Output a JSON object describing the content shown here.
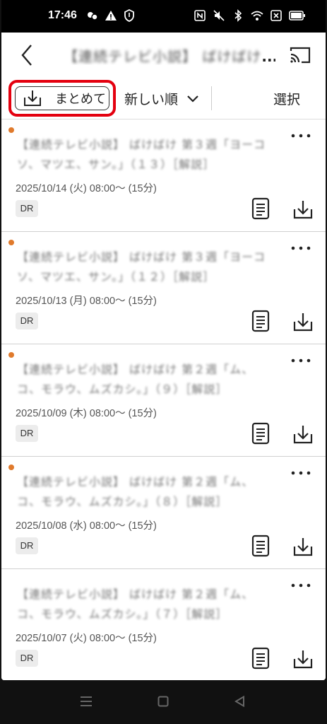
{
  "status": {
    "time": "17:46",
    "left_icons": [
      "link-icon",
      "warning-icon",
      "shield-icon"
    ],
    "right_icons": [
      "nfc-icon",
      "mute-icon",
      "bluetooth-icon",
      "wifi-icon",
      "x-box-icon",
      "battery-icon"
    ]
  },
  "appbar": {
    "title_blurred": "【連続テレビ小説】 ばけばけ",
    "title_ellipsis": "..."
  },
  "toolbar": {
    "bulk_download_label": "まとめて",
    "sort_label": "新しい順",
    "select_label": "選択"
  },
  "episodes": [
    {
      "title": "【連続テレビ小説】 ばけばけ 第３週「ヨーコソ、マツエ、サン。」（１３）［解説］",
      "date": "2025/10/14 (火) 08:00～ (15分)",
      "badge": "DR"
    },
    {
      "title": "【連続テレビ小説】 ばけばけ 第３週「ヨーコソ、マツエ、サン。」（１２）［解説］",
      "date": "2025/10/13 (月) 08:00～ (15分)",
      "badge": "DR"
    },
    {
      "title": "【連続テレビ小説】 ばけばけ 第２週「ム、コ、モラウ、ムズカシ。」（９）［解説］",
      "date": "2025/10/09 (木) 08:00～ (15分)",
      "badge": "DR"
    },
    {
      "title": "【連続テレビ小説】 ばけばけ 第２週「ム、コ、モラウ、ムズカシ。」（８）［解説］",
      "date": "2025/10/08 (水) 08:00～ (15分)",
      "badge": "DR"
    },
    {
      "title": "【連続テレビ小説】 ばけばけ 第２週「ム、コ、モラウ、ムズカシ。」（７）［解説］",
      "date": "2025/10/07 (火) 08:00～ (15分)",
      "badge": "DR"
    }
  ],
  "colors": {
    "highlight": "#e4000f",
    "unwatched_dot": "#e07a2c"
  }
}
